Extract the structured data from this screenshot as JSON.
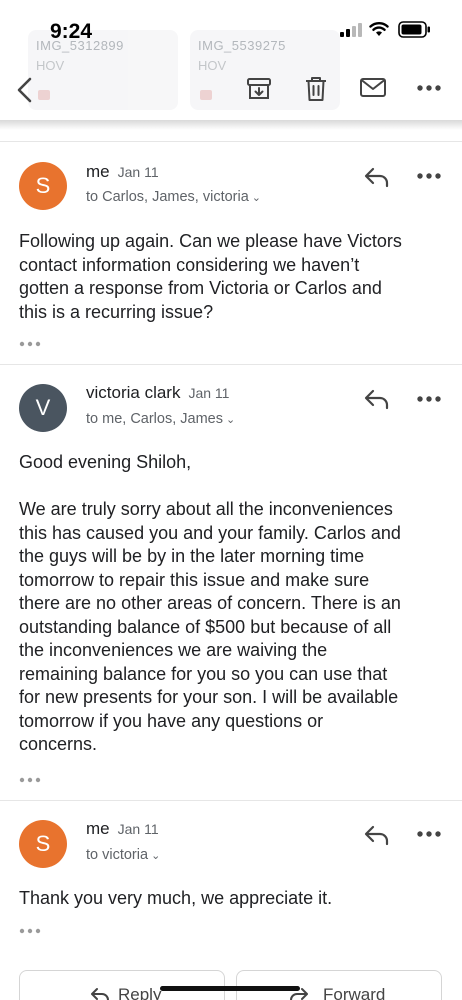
{
  "status_bar": {
    "time": "9:24"
  },
  "attachments_behind": [
    {
      "name": "IMG_5312899",
      "sub": "HOV"
    },
    {
      "name": "IMG_5539275",
      "sub": "HOV"
    }
  ],
  "toolbar": {
    "back": "back-icon",
    "archive": "archive-icon",
    "delete": "delete-icon",
    "mark_unread": "mail-icon",
    "more": "more-icon"
  },
  "colors": {
    "avatar_me": "#e8732e",
    "avatar_victoria": "#4a5560"
  },
  "messages": [
    {
      "avatar_letter": "S",
      "sender": "me",
      "date": "Jan 11",
      "recipients": "to Carlos, James, victoria",
      "body": [
        "Following up again. Can we please have Victors",
        "contact information considering we haven’t",
        "gotten a response from Victoria or Carlos and",
        "this is a recurring issue?"
      ]
    },
    {
      "avatar_letter": "V",
      "sender": "victoria clark",
      "date": "Jan 11",
      "recipients": "to me, Carlos, James",
      "body": [
        "Good evening Shiloh,",
        "",
        "We are truly sorry about all the inconveniences",
        "this has caused you and your family. Carlos and",
        "the guys will be by in the later morning time",
        "tomorrow to repair this issue and make sure",
        "there are no other areas of concern. There is an",
        "outstanding balance of $500 but because of all",
        "the inconveniences we are waiving the",
        "remaining balance for you so you can use that",
        "for new presents for your son. I will be available",
        "tomorrow if you have any questions or",
        "concerns."
      ]
    },
    {
      "avatar_letter": "S",
      "sender": "me",
      "date": "Jan 11",
      "recipients": "to victoria",
      "body": [
        "Thank you very much, we appreciate it."
      ]
    }
  ],
  "actions": {
    "reply_label": "Reply",
    "forward_label": "Forward"
  }
}
